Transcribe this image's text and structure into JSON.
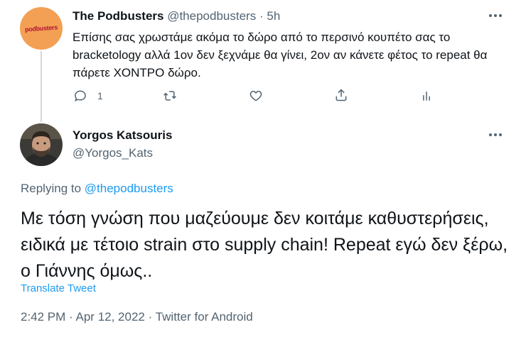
{
  "parent_tweet": {
    "avatar_label": "podbusters",
    "name": "The Podbusters",
    "handle": "@thepodbusters",
    "separator": "·",
    "time": "5h",
    "text": "Επίσης σας χρωστάμε ακόμα το δώρο από το περσινό κουπέτο σας το bracketology αλλά 1ον δεν ξεχνάμε θα γίνει, 2ον αν κάνετε φέτος το repeat θα πάρετε ΧΟΝΤΡΟ δώρο.",
    "reply_count": "1",
    "icons": {
      "reply": "reply-icon",
      "retweet": "retweet-icon",
      "like": "like-icon",
      "share": "share-icon",
      "analytics": "analytics-icon",
      "more": "more-icon"
    }
  },
  "main_tweet": {
    "name": "Yorgos Katsouris",
    "handle": "@Yorgos_Kats",
    "replying_prefix": "Replying to",
    "replying_to": "@thepodbusters",
    "text": "Με τόση γνώση που μαζεύουμε δεν κοιτάμε καθυστερήσεις, ειδικά με τέτοιο strain στο supply chain! Repeat εγώ δεν ξέρω, ο Γιάννης όμως..",
    "translate_label": "Translate Tweet",
    "time": "2:42 PM",
    "date": "Apr 12, 2022",
    "source": "Twitter for Android",
    "separator": "·"
  },
  "colors": {
    "accent": "#1d9bf0",
    "muted": "#536471",
    "text": "#0f1419",
    "podbusters_orange": "#f3a054"
  }
}
